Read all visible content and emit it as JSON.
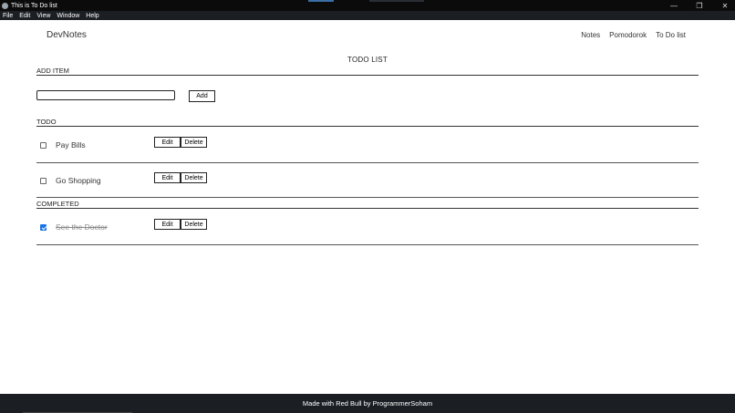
{
  "window": {
    "title": "This is To Do list",
    "controls": [
      "—",
      "❐",
      "✕"
    ]
  },
  "menu": [
    "File",
    "Edit",
    "View",
    "Window",
    "Help"
  ],
  "nav": {
    "brand": "DevNotes",
    "links": [
      "Notes",
      "Pomodorok",
      "To Do list"
    ]
  },
  "page_title": "TODO LIST",
  "add_section": {
    "label": "ADD ITEM",
    "input_value": "",
    "button_label": "Add"
  },
  "todo_section": {
    "label": "TODO",
    "items": [
      {
        "text": "Pay Bills",
        "checked": false,
        "edit_label": "Edit",
        "delete_label": "Delete"
      },
      {
        "text": "Go Shopping",
        "checked": false,
        "edit_label": "Edit",
        "delete_label": "Delete"
      }
    ]
  },
  "completed_section": {
    "label": "COMPLETED",
    "items": [
      {
        "text": "See the Doctor",
        "checked": true,
        "edit_label": "Edit",
        "delete_label": "Delete"
      }
    ]
  },
  "footer": {
    "text": "Made with Red Bull by ProgrammerSoham"
  }
}
